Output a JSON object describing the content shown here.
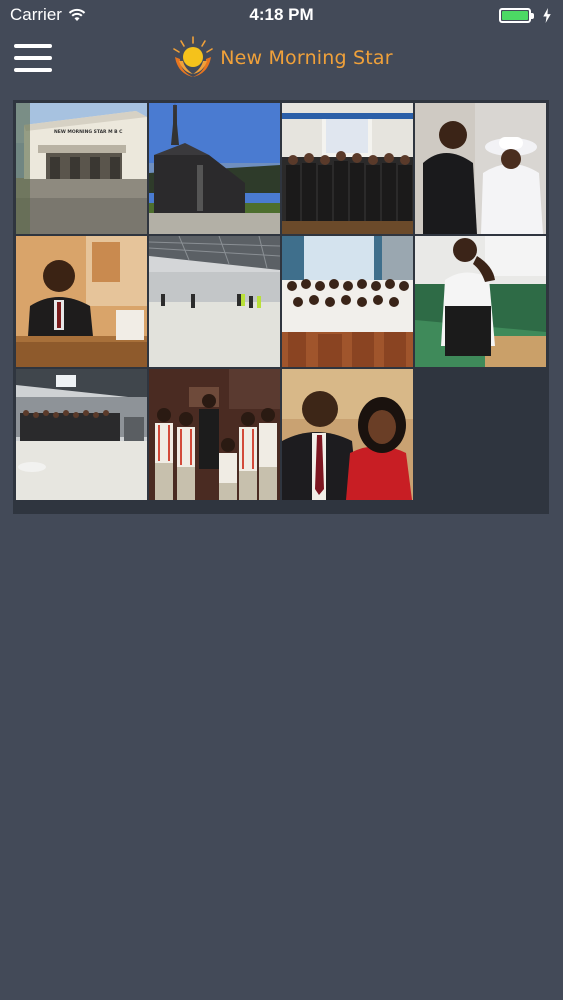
{
  "status_bar": {
    "carrier": "Carrier",
    "time": "4:18 PM",
    "battery_level": 1.0,
    "battery_color": "#4cd964"
  },
  "header": {
    "menu_icon": "hamburger-menu-icon",
    "logo_icon": "sunrise-hands-logo",
    "title": "New Morning Star",
    "title_color": "#f0a13a"
  },
  "gallery": {
    "background": "#2f353f",
    "photos": [
      {
        "name": "church-building-photo",
        "sign": "NEW MORNING STAR M B C"
      },
      {
        "name": "chapel-exterior-photo"
      },
      {
        "name": "men-in-suits-group-photo"
      },
      {
        "name": "couple-in-church-photo"
      },
      {
        "name": "pastor-preaching-photo"
      },
      {
        "name": "gym-activity-photo"
      },
      {
        "name": "choir-in-white-photo"
      },
      {
        "name": "woman-praising-photo"
      },
      {
        "name": "gym-audience-photo"
      },
      {
        "name": "youth-group-photo"
      },
      {
        "name": "pastor-and-wife-photo"
      }
    ]
  }
}
